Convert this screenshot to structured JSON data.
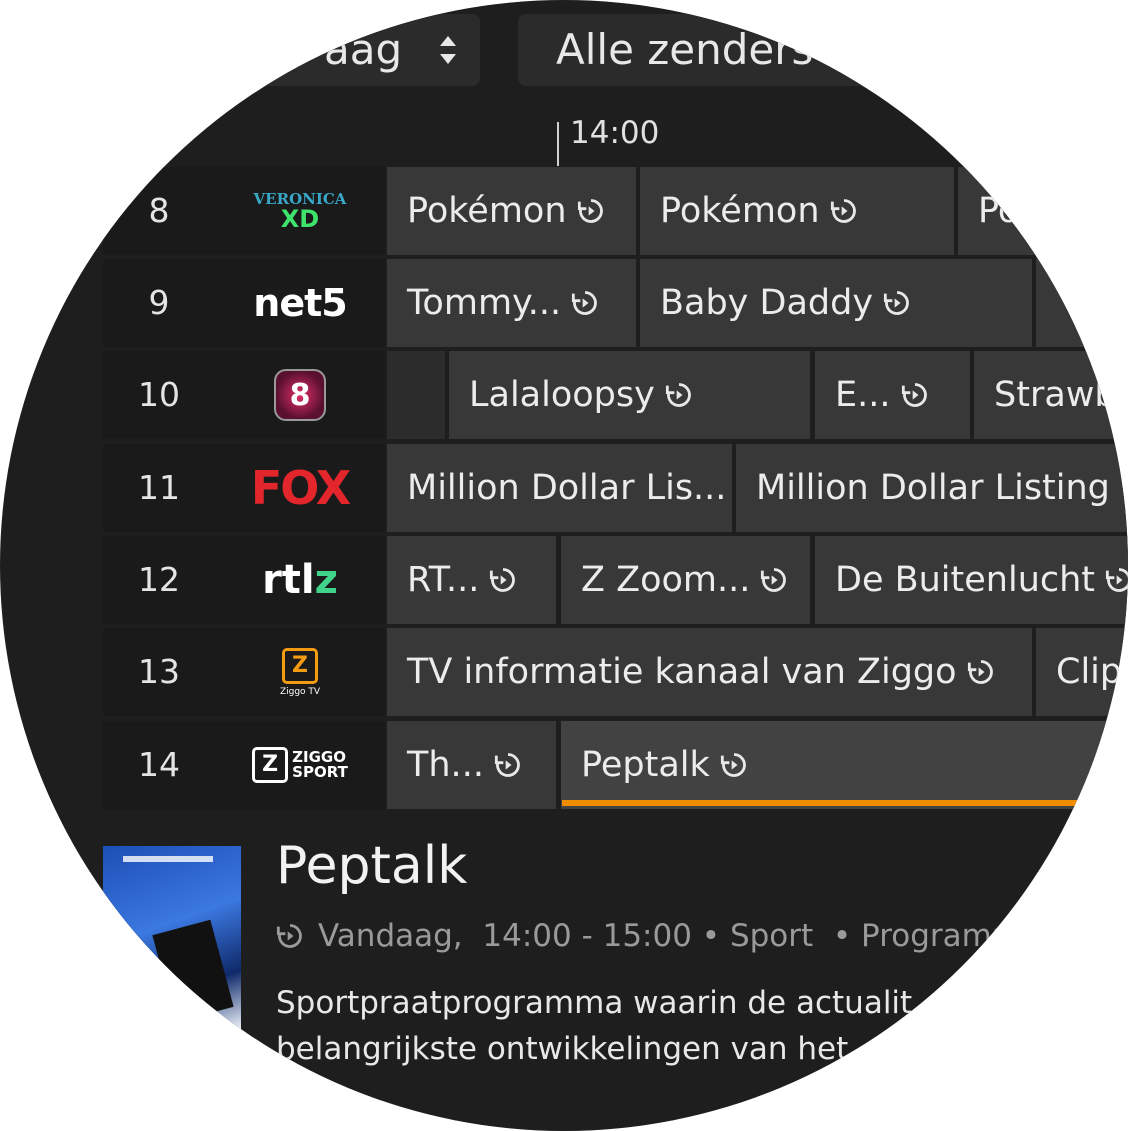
{
  "header": {
    "day_selector": "aag",
    "channel_filter": "Alle zenders"
  },
  "timeline": {
    "time": "14:00"
  },
  "channels": [
    {
      "number": "8",
      "logo": "Veronica XD",
      "logo_text": "VERONICA",
      "logo_sub": "XD",
      "programs": [
        {
          "title": "Pokémon"
        },
        {
          "title": "Pokémon"
        },
        {
          "title": "Po"
        }
      ]
    },
    {
      "number": "9",
      "logo": "net5",
      "logo_text": "net5",
      "programs": [
        {
          "title": "Tommy..."
        },
        {
          "title": "Baby Daddy"
        },
        {
          "title": ""
        }
      ]
    },
    {
      "number": "10",
      "logo": "RTL 8",
      "logo_text": "8",
      "programs": [
        {
          "title": ""
        },
        {
          "title": "Lalaloopsy"
        },
        {
          "title": "E..."
        },
        {
          "title": "Strawb"
        }
      ]
    },
    {
      "number": "11",
      "logo": "FOX",
      "logo_text": "FOX",
      "programs": [
        {
          "title": "Million Dollar Lis..."
        },
        {
          "title": "Million Dollar Listing"
        }
      ]
    },
    {
      "number": "12",
      "logo": "RTL Z",
      "logo_text": "rtl",
      "logo_sub": "z",
      "programs": [
        {
          "title": "RT..."
        },
        {
          "title": "Z Zoom..."
        },
        {
          "title": "De Buitenlucht"
        }
      ]
    },
    {
      "number": "13",
      "logo": "Ziggo TV",
      "logo_text": "Z",
      "logo_sub": "Ziggo TV",
      "programs": [
        {
          "title": "TV informatie kanaal van Ziggo"
        },
        {
          "title": "Clip"
        }
      ]
    },
    {
      "number": "14",
      "logo": "Ziggo Sport",
      "logo_text": "ZIGGO",
      "logo_sub": "SPORT",
      "programs": [
        {
          "title": "Th..."
        },
        {
          "title": "Peptalk"
        }
      ]
    }
  ],
  "detail": {
    "title": "Peptalk",
    "day": "Vandaag,",
    "time": "14:00 - 15:00",
    "genre": "Sport",
    "type": "Programm",
    "description_line1": "Sportpraatprogramma waarin de actualit",
    "description_line2": "belangrijkste ontwikkelingen van het"
  },
  "colors": {
    "accent": "#f08c00",
    "background": "#1e1e1e",
    "cell": "#383838"
  }
}
